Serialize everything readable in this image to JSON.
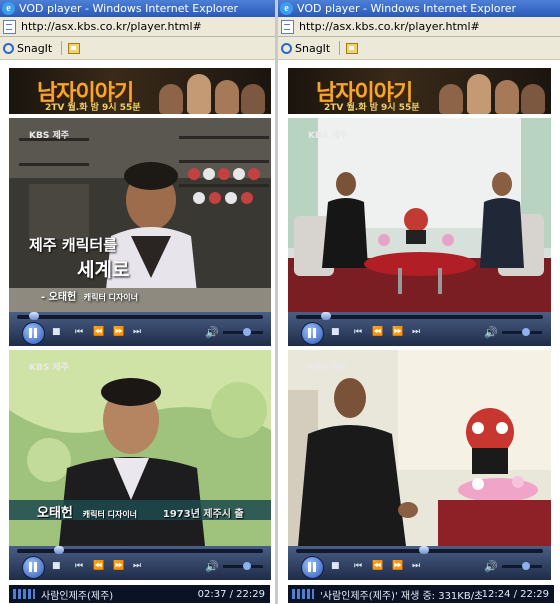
{
  "windows": [
    {
      "title": "VOD player - Windows Internet Explorer",
      "url": "http://asx.kbs.co.kr/player.html#",
      "toolbar": {
        "snagit_label": "SnagIt"
      },
      "banner": {
        "title": "남자이야기",
        "subtitle": "2TV 월.화 밤 9시 55분"
      },
      "players": [
        {
          "channel_logo": "KBS 제주",
          "caption_line1": "제주 캐릭터를",
          "caption_line2": "세계로",
          "caption_name": "- 오태헌",
          "caption_role": "캐릭터 디자이너",
          "seek_fraction": 0.07
        },
        {
          "channel_logo": "KBS 제주",
          "caption_name": "오태헌",
          "caption_role": "캐릭터 디자이너",
          "caption_extra": "1973년 제주시 출",
          "seek_fraction": 0.17
        }
      ],
      "status": {
        "text": "사람인제주(제주)",
        "time": "02:37 / 22:29"
      }
    },
    {
      "title": "VOD player - Windows Internet Explorer",
      "url": "http://asx.kbs.co.kr/player.html#",
      "toolbar": {
        "snagit_label": "SnagIt"
      },
      "banner": {
        "title": "남자이야기",
        "subtitle": "2TV 월.화 밤 9시 55분"
      },
      "players": [
        {
          "channel_logo": "KBS 제주",
          "seek_fraction": 0.12
        },
        {
          "channel_logo": "KBS 제주",
          "seek_fraction": 0.52
        }
      ],
      "status": {
        "text": "'사람인제주(제주)' 재생 중: 331KB/초",
        "time": "12:24 / 22:29"
      }
    }
  ],
  "colors": {
    "titlebar": "#2a5ab8",
    "controls": "#1f2c48",
    "statusbar": "#0a1226",
    "banner_accent": "#f2a92b"
  }
}
